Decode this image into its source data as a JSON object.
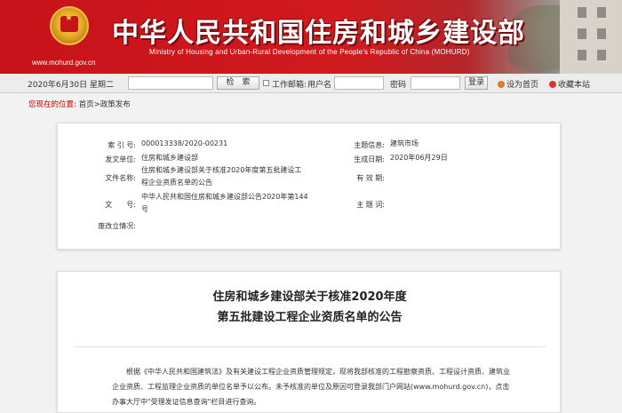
{
  "banner": {
    "site_url": "www.mohurd.gov.cn",
    "title": "中华人民共和国住房和城乡建设部",
    "subtitle": "Ministry of Housing and Urban-Rural Development of the People's Republic of China (MOHURD)"
  },
  "toolbar": {
    "date": "2020年6月30日 星期二",
    "search_button": "检　索",
    "workbase_label": "工作邮箱:",
    "username_label": "用户名",
    "password_label": "密码",
    "login_button": "登录",
    "set_home": "设为首页",
    "bookmark": "收藏本站"
  },
  "breadcrumb": {
    "location_label": "您现在的位置:",
    "path": "首页>政策发布"
  },
  "info": {
    "index_label": "索 引 号:",
    "index_value": "000013338/2020-00231",
    "topic_label": "主题信息:",
    "topic_value": "建筑市场",
    "issuer_label": "发文单位:",
    "issuer_value": "住房和城乡建设部",
    "date_label": "生成日期:",
    "date_value": "2020年06月29日",
    "filename_label": "文件名称:",
    "filename_value_1": "住房和城乡建设部关于核准2020年度第五批建设工",
    "filename_value_2": "程企业资质名单的公告",
    "valid_label": "有 效 期:",
    "docno_label": "文　　号:",
    "docno_value_1": "中华人民共和国住房和城乡建设部公告2020年第144",
    "docno_value_2": "号",
    "subject_label": "主 题 词:",
    "abolish_label": "废改立情况:"
  },
  "document": {
    "title_line1": "住房和城乡建设部关于核准2020年度",
    "title_line2": "第五批建设工程企业资质名单的公告",
    "body": "根据《中华人民共和国建筑法》及有关建设工程企业资质管理规定，现将我部核准的工程勘察资质、工程设计资质、建筑业企业资质、工程监理企业资质的单位名单予以公布。未予核准的单位及原因可登录我部门户网站(www.mohurd.gov.cn)，点击办事大厅中\"受理发证信息查询\"栏目进行查询。"
  },
  "colors": {
    "banner_red": "#c8121a",
    "breadcrumb_red": "#c00"
  }
}
